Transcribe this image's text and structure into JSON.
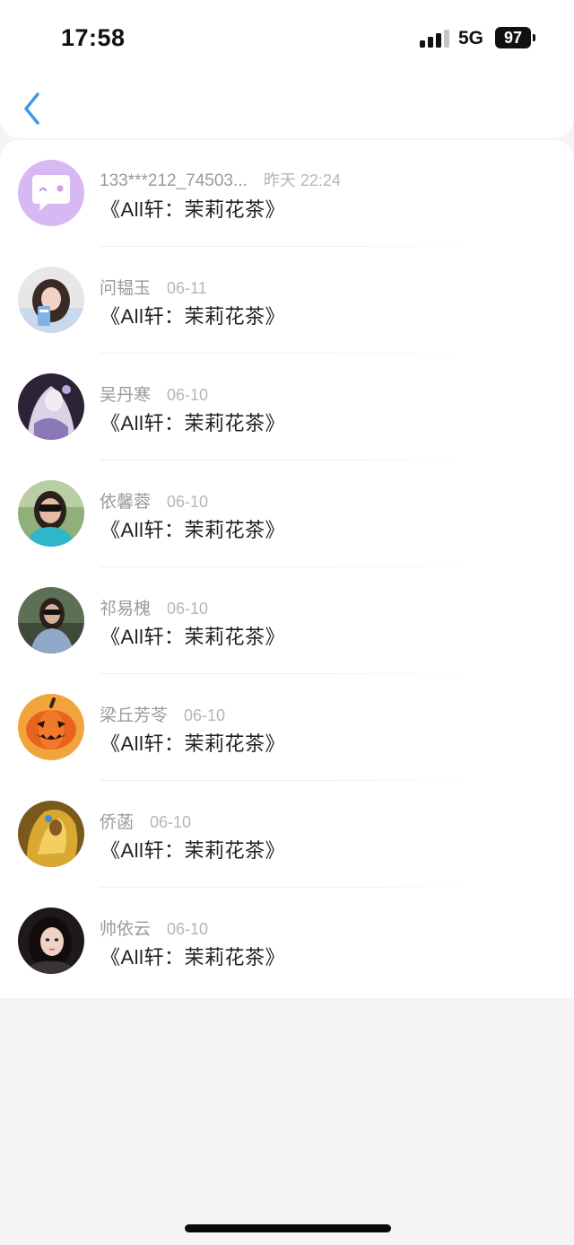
{
  "status_bar": {
    "time": "17:58",
    "network": "5G",
    "battery": "97"
  },
  "nav": {
    "back_icon": "chevron-left-icon",
    "accent_color": "#3b9ae8"
  },
  "list": {
    "items": [
      {
        "name": "133***212_74503...",
        "date": "昨天 22:24",
        "message": "《All轩：茉莉花茶》",
        "avatar": "default-chat-avatar"
      },
      {
        "name": "问韫玉",
        "date": "06-11",
        "message": "《All轩：茉莉花茶》",
        "avatar": "user-photo"
      },
      {
        "name": "吴丹寒",
        "date": "06-10",
        "message": "《All轩：茉莉花茶》",
        "avatar": "anime-avatar"
      },
      {
        "name": "依馨蓉",
        "date": "06-10",
        "message": "《All轩：茉莉花茶》",
        "avatar": "user-photo"
      },
      {
        "name": "祁易槐",
        "date": "06-10",
        "message": "《All轩：茉莉花茶》",
        "avatar": "user-photo"
      },
      {
        "name": "梁丘芳苓",
        "date": "06-10",
        "message": "《All轩：茉莉花茶》",
        "avatar": "pumpkin-avatar"
      },
      {
        "name": "侨菡",
        "date": "06-10",
        "message": "《All轩：茉莉花茶》",
        "avatar": "golden-warrior-avatar"
      },
      {
        "name": "帅依云",
        "date": "06-10",
        "message": "《All轩：茉莉花茶》",
        "avatar": "user-photo"
      }
    ]
  }
}
